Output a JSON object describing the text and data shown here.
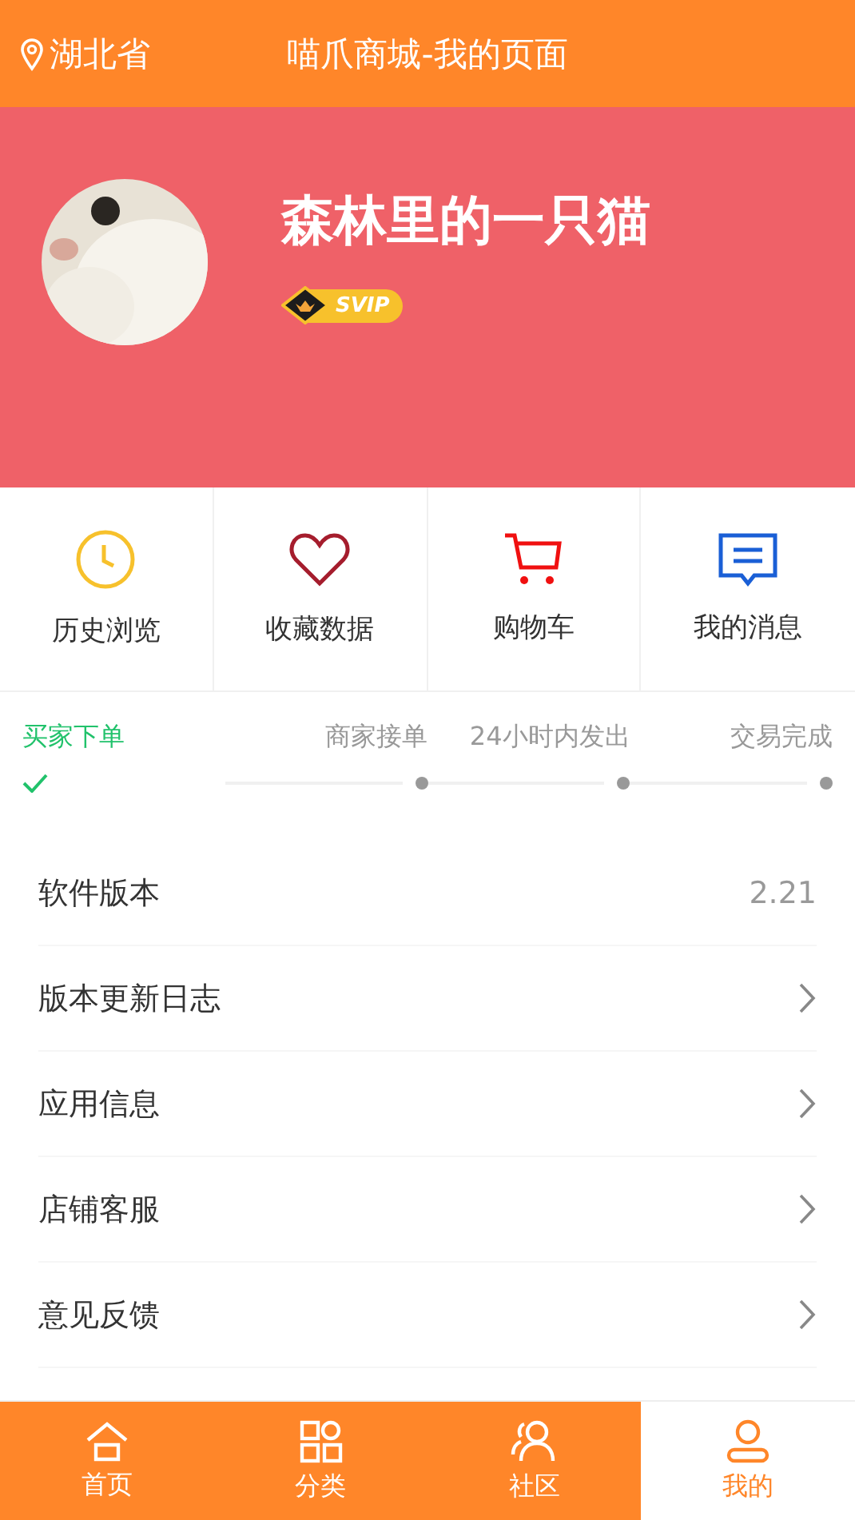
{
  "header": {
    "location": "湖北省",
    "title": "喵爪商城-我的页面"
  },
  "profile": {
    "name": "森林里的一只猫",
    "badge": "SVIP"
  },
  "shortcuts": [
    {
      "kind": "clock",
      "label": "历史浏览"
    },
    {
      "kind": "heart",
      "label": "收藏数据"
    },
    {
      "kind": "cart",
      "label": "购物车"
    },
    {
      "kind": "message",
      "label": "我的消息"
    }
  ],
  "order_steps": [
    {
      "label": "买家下单",
      "done": true
    },
    {
      "label": "商家接单",
      "done": false
    },
    {
      "label": "24小时内发出",
      "done": false
    },
    {
      "label": "交易完成",
      "done": false
    }
  ],
  "menu": [
    {
      "label": "软件版本",
      "value": "2.21"
    },
    {
      "label": "版本更新日志",
      "arrow": true
    },
    {
      "label": "应用信息",
      "arrow": true
    },
    {
      "label": "店铺客服",
      "arrow": true
    },
    {
      "label": "意见反馈",
      "arrow": true
    }
  ],
  "tab_bar": [
    {
      "kind": "home",
      "label": "首页",
      "selected": false
    },
    {
      "kind": "grid",
      "label": "分类",
      "selected": false
    },
    {
      "kind": "community",
      "label": "社区",
      "selected": false
    },
    {
      "kind": "user",
      "label": "我的",
      "selected": true
    }
  ]
}
